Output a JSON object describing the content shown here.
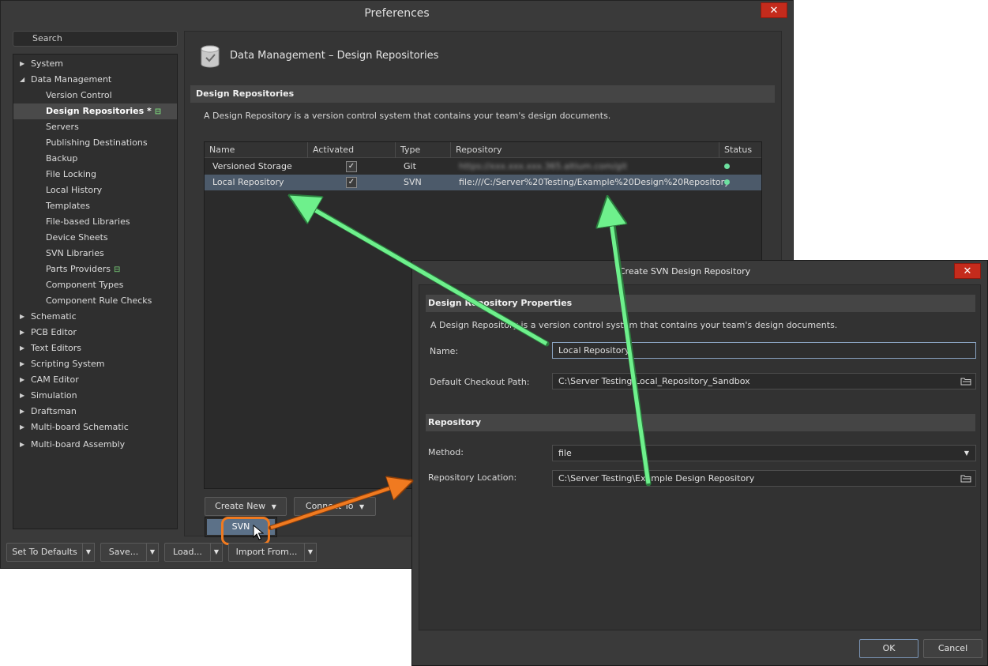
{
  "preferences": {
    "title": "Preferences",
    "close_glyph": "✕",
    "search_placeholder": "Search",
    "tree": [
      {
        "label": "System",
        "level": 0,
        "expanded": false
      },
      {
        "label": "Data Management",
        "level": 0,
        "expanded": true
      },
      {
        "label": "Version Control",
        "level": 1
      },
      {
        "label": "Design Repositories *",
        "level": 1,
        "selected": true,
        "badge": true
      },
      {
        "label": "Servers",
        "level": 1
      },
      {
        "label": "Publishing Destinations",
        "level": 1
      },
      {
        "label": "Backup",
        "level": 1
      },
      {
        "label": "File Locking",
        "level": 1
      },
      {
        "label": "Local History",
        "level": 1
      },
      {
        "label": "Templates",
        "level": 1
      },
      {
        "label": "File-based Libraries",
        "level": 1
      },
      {
        "label": "Device Sheets",
        "level": 1
      },
      {
        "label": "SVN Libraries",
        "level": 1
      },
      {
        "label": "Parts Providers",
        "level": 1,
        "badge": true
      },
      {
        "label": "Component Types",
        "level": 1
      },
      {
        "label": "Component Rule Checks",
        "level": 1
      },
      {
        "label": "Schematic",
        "level": 0,
        "expanded": false
      },
      {
        "label": "PCB Editor",
        "level": 0,
        "expanded": false
      },
      {
        "label": "Text Editors",
        "level": 0,
        "expanded": false
      },
      {
        "label": "Scripting System",
        "level": 0,
        "expanded": false
      },
      {
        "label": "CAM Editor",
        "level": 0,
        "expanded": false
      },
      {
        "label": "Simulation",
        "level": 0,
        "expanded": false
      },
      {
        "label": "Draftsman",
        "level": 0,
        "expanded": false
      },
      {
        "label": "Multi-board Schematic",
        "level": 0,
        "expanded": false
      },
      {
        "label": "Multi-board Assembly",
        "level": 0,
        "expanded": false
      }
    ],
    "page_title": "Data Management – Design Repositories",
    "section_title": "Design Repositories",
    "section_description": "A Design Repository is a version control system that contains your team's design documents.",
    "table": {
      "columns": [
        "Name",
        "Activated",
        "Type",
        "Repository",
        "Status"
      ],
      "rows": [
        {
          "name": "Versioned Storage",
          "activated": true,
          "type": "Git",
          "repository": "https://xxx.xxx.xxx.365.altium.com/git",
          "status": "online",
          "blurred": true,
          "selected": false
        },
        {
          "name": "Local Repository",
          "activated": true,
          "type": "SVN",
          "repository": "file:///C:/Server%20Testing/Example%20Design%20Repository",
          "status": "online",
          "blurred": false,
          "selected": true
        }
      ]
    },
    "create_new_label": "Create New",
    "connect_to_label": "Connect To",
    "svn_menu_item": "SVN",
    "bottom_buttons": {
      "set_defaults": "Set To Defaults",
      "save": "Save...",
      "load": "Load...",
      "import_from": "Import From..."
    },
    "checkmark_glyph": "✓",
    "dropdown_glyph": "▼",
    "colors": {
      "selection": "#4c5a6a",
      "status_online": "#6de0a0",
      "callout_orange": "#f07a20",
      "callout_green": "#6ef08c"
    }
  },
  "dialog": {
    "title": "Create SVN Design Repository",
    "close_glyph": "✕",
    "properties_section": "Design Repository Properties",
    "description": "A Design Repository is a version control system that contains your team's design documents.",
    "name_label": "Name:",
    "name_value": "Local Repository",
    "checkout_label": "Default Checkout Path:",
    "checkout_value": "C:\\Server Testing\\Local_Repository_Sandbox",
    "repository_section": "Repository",
    "method_label": "Method:",
    "method_value": "file",
    "location_label": "Repository Location:",
    "location_value": "C:\\Server Testing\\Example Design Repository",
    "ok_label": "OK",
    "cancel_label": "Cancel"
  }
}
